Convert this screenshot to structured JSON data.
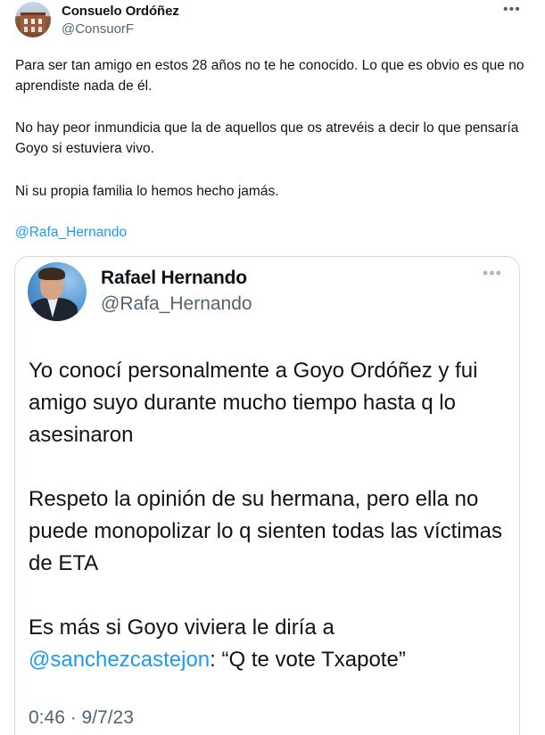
{
  "outer_tweet": {
    "author_name": "Consuelo Ordóñez",
    "author_handle": "@ConsuorF",
    "more_glyph": "•••",
    "paragraphs": [
      "Para ser tan amigo en estos 28 años no te he conocido. Lo que es obvio es que no aprendiste nada de él.",
      "No hay peor inmundicia que la de aquellos que os atrevéis a decir lo que pensaría Goyo si estuviera vivo.",
      "Ni su propia familia lo hemos hecho jamás."
    ],
    "mention": "@Rafa_Hernando",
    "avatar_icon": "profile-photo-building"
  },
  "quoted_tweet": {
    "author_name": "Rafael Hernando",
    "author_handle": "@Rafa_Hernando",
    "more_glyph": "•••",
    "paragraph1": "Yo conocí personalmente a Goyo Ordóñez y fui amigo suyo durante mucho tiempo hasta q lo asesinaron",
    "paragraph2": "Respeto la opinión de su hermana, pero ella no puede monopolizar lo q sienten todas las víctimas de ETA",
    "paragraph3_prefix": "Es más si Goyo viviera le diría a ",
    "paragraph3_mention": "@sanchezcastejon",
    "paragraph3_suffix": ": “Q te vote Txapote”",
    "timestamp": "0:46 · 9/7/23",
    "avatar_icon": "profile-photo-man"
  },
  "colors": {
    "link": "#1d9bf0",
    "secondary_text": "#536471",
    "primary_text": "#0f1419",
    "border": "#cfd9de"
  }
}
